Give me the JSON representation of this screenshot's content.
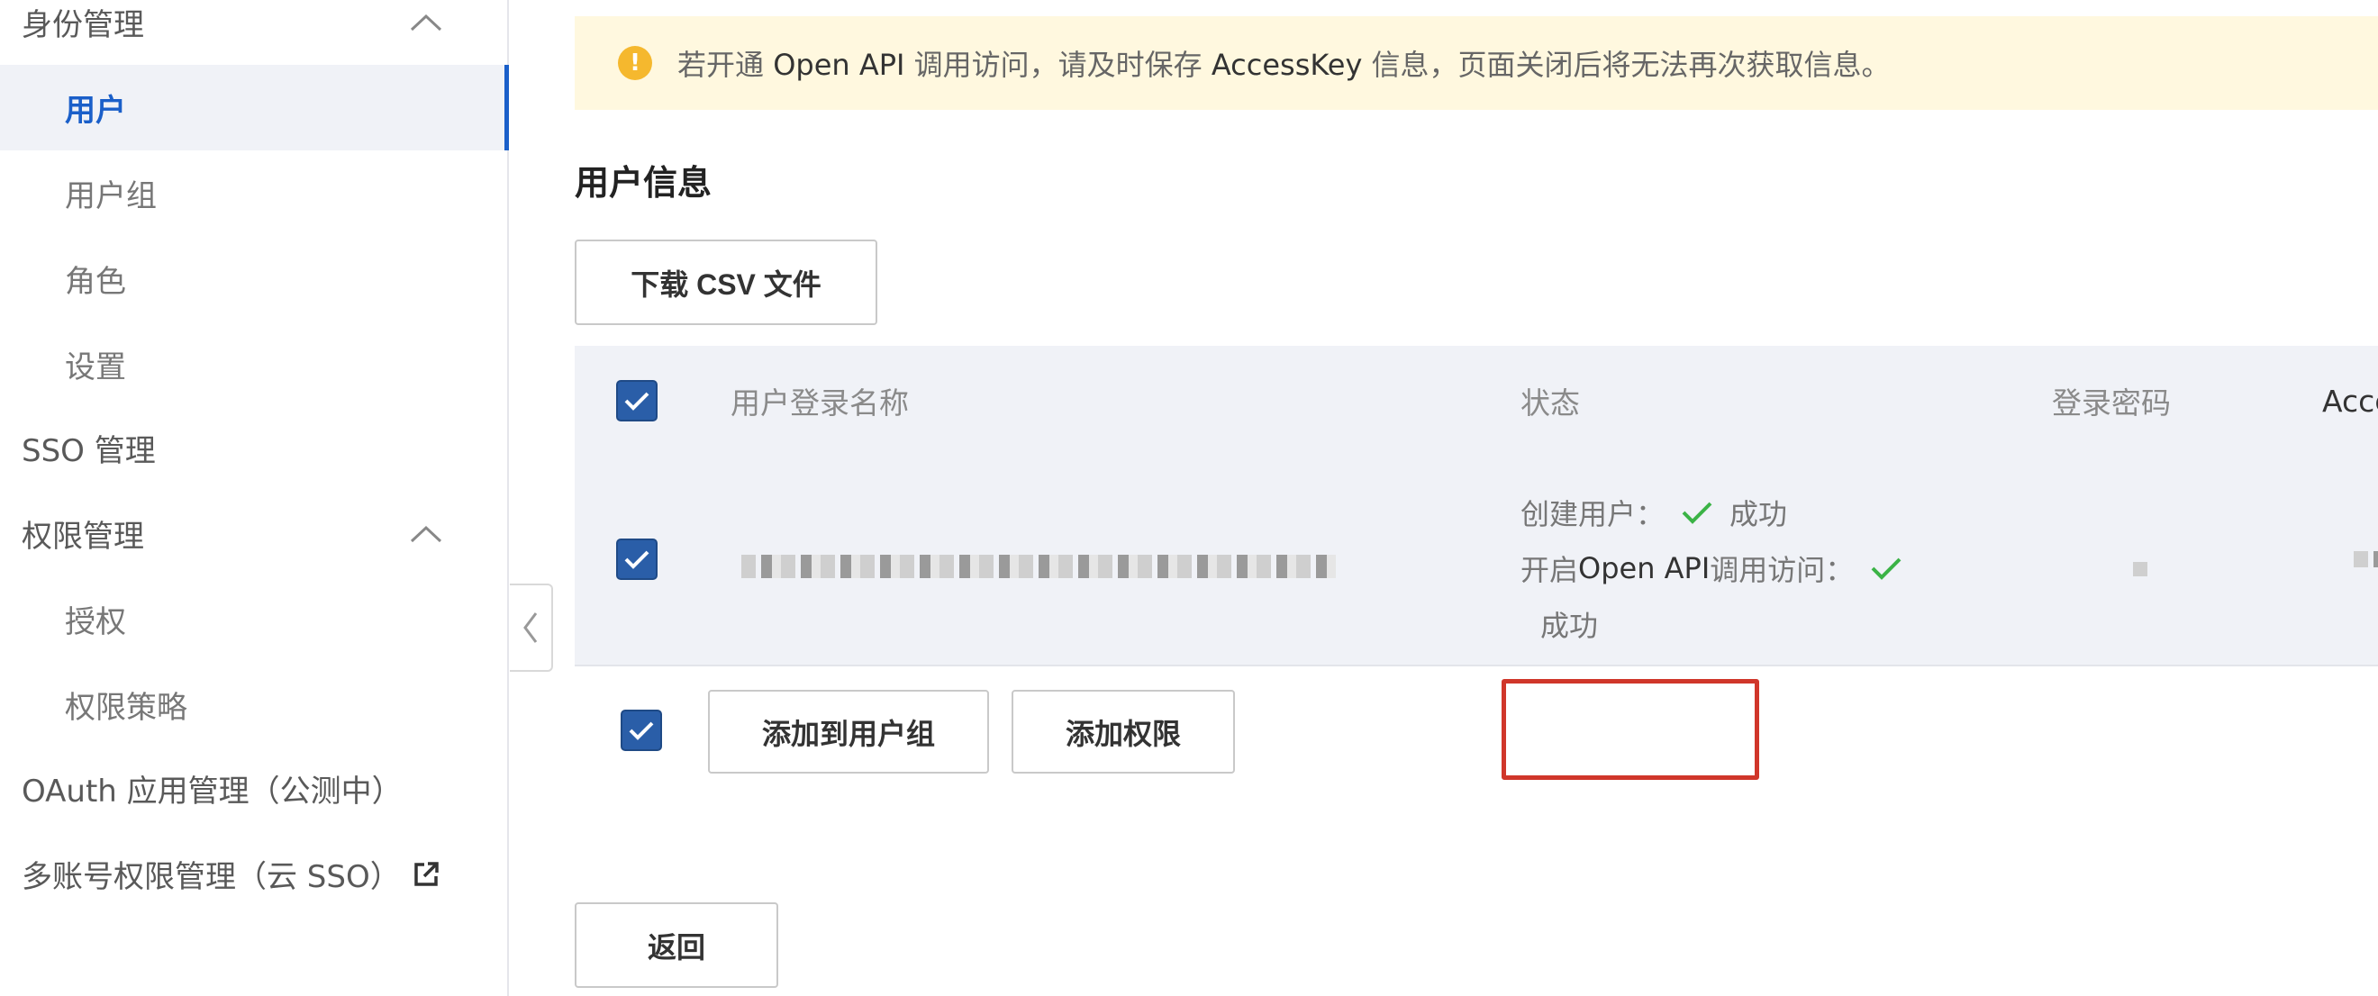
{
  "sidebar": {
    "identity_group": "身份管理",
    "items": [
      {
        "label": "用户",
        "active": true
      },
      {
        "label": "用户组"
      },
      {
        "label": "角色"
      },
      {
        "label": "设置"
      }
    ],
    "sso": "SSO 管理",
    "permission_group": "权限管理",
    "permission_items": [
      {
        "label": "授权"
      },
      {
        "label": "权限策略"
      }
    ],
    "oauth": "OAuth 应用管理（公测中）",
    "multi_account": "多账号权限管理（云 SSO）"
  },
  "alert": {
    "part1": "若开通 ",
    "b1": "Open API",
    "part2": " 调用访问，请及时保存 ",
    "b2": "AccessKey",
    "part3": " 信息，页面关闭后将无法再次获取信息。",
    "icon": "warning-icon"
  },
  "main": {
    "section_title": "用户信息",
    "download_csv": "下载 CSV 文件",
    "table": {
      "headers": [
        "用户登录名称",
        "状态",
        "登录密码",
        "AccessK"
      ],
      "row": {
        "status_create_label": "创建用户：",
        "status_create_result": "成功",
        "status_api_prefix": "开启 ",
        "status_api_bold": "Open API",
        "status_api_suffix": " 调用访问：",
        "status_api_result": "成功"
      }
    },
    "add_to_group": "添加到用户组",
    "add_permission": "添加权限",
    "back": "返回"
  },
  "colors": {
    "accent": "#1a5fc9",
    "checkbox": "#2a5ea8",
    "success": "#3bb346",
    "highlight": "#d0362a",
    "alert_bg": "#fff8df"
  }
}
